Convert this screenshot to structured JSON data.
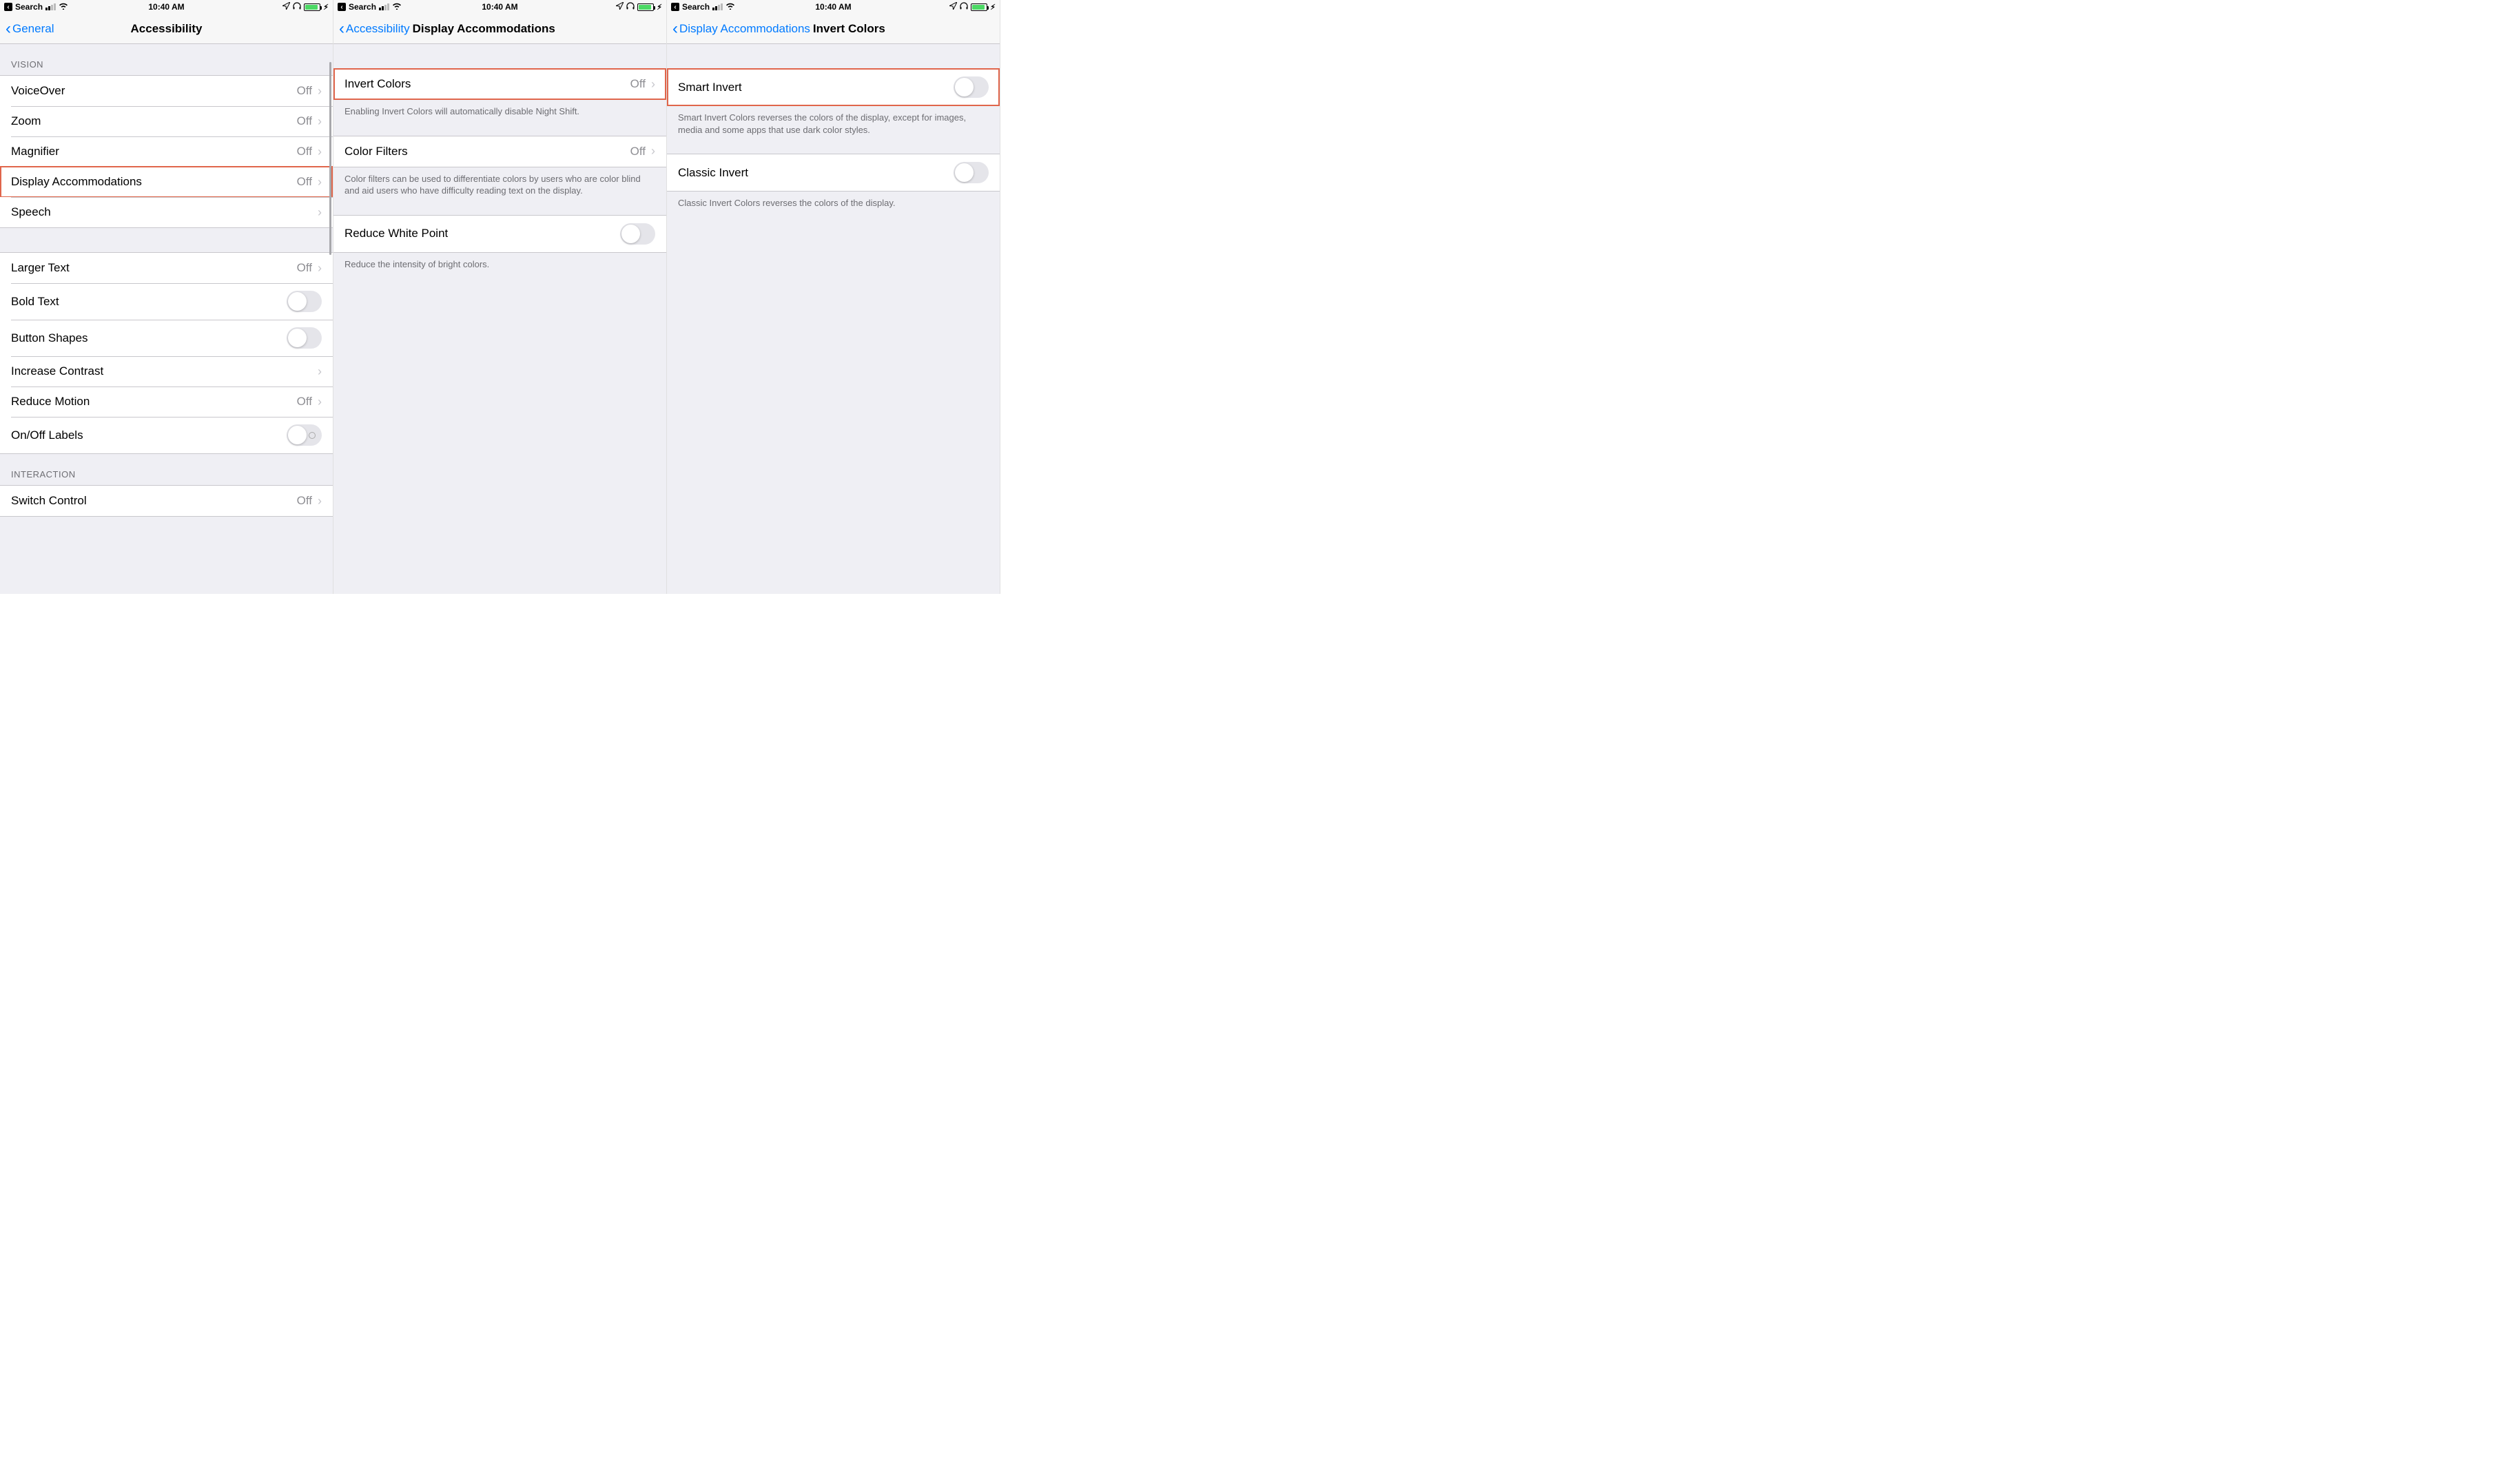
{
  "status": {
    "back_app": "Search",
    "time": "10:40 AM"
  },
  "screens": [
    {
      "back_label": "General",
      "title": "Accessibility",
      "sections": [
        {
          "header": "VISION",
          "rows": [
            {
              "label": "VoiceOver",
              "value": "Off",
              "kind": "disclosure"
            },
            {
              "label": "Zoom",
              "value": "Off",
              "kind": "disclosure"
            },
            {
              "label": "Magnifier",
              "value": "Off",
              "kind": "disclosure"
            },
            {
              "label": "Display Accommodations",
              "value": "Off",
              "kind": "disclosure",
              "highlight": true
            },
            {
              "label": "Speech",
              "value": "",
              "kind": "disclosure"
            }
          ]
        },
        {
          "rows": [
            {
              "label": "Larger Text",
              "value": "Off",
              "kind": "disclosure"
            },
            {
              "label": "Bold Text",
              "kind": "toggle",
              "on": false
            },
            {
              "label": "Button Shapes",
              "kind": "toggle",
              "on": false
            },
            {
              "label": "Increase Contrast",
              "value": "",
              "kind": "disclosure"
            },
            {
              "label": "Reduce Motion",
              "value": "Off",
              "kind": "disclosure"
            },
            {
              "label": "On/Off Labels",
              "kind": "toggle",
              "on": false,
              "labeled": true
            }
          ]
        },
        {
          "header": "INTERACTION",
          "rows": [
            {
              "label": "Switch Control",
              "value": "Off",
              "kind": "disclosure"
            }
          ]
        }
      ]
    },
    {
      "back_label": "Accessibility",
      "title": "Display Accommodations",
      "sections": [
        {
          "rows": [
            {
              "label": "Invert Colors",
              "value": "Off",
              "kind": "disclosure",
              "highlight": true
            }
          ],
          "footer": "Enabling Invert Colors will automatically disable Night Shift."
        },
        {
          "rows": [
            {
              "label": "Color Filters",
              "value": "Off",
              "kind": "disclosure"
            }
          ],
          "footer": "Color filters can be used to differentiate colors by users who are color blind and aid users who have difficulty reading text on the display."
        },
        {
          "rows": [
            {
              "label": "Reduce White Point",
              "kind": "toggle",
              "on": false
            }
          ],
          "footer": "Reduce the intensity of bright colors."
        }
      ]
    },
    {
      "back_label": "Display Accommodations",
      "title": "Invert Colors",
      "sections": [
        {
          "rows": [
            {
              "label": "Smart Invert",
              "kind": "toggle",
              "on": false,
              "highlight": true
            }
          ],
          "footer": "Smart Invert Colors reverses the colors of the display, except for images, media and some apps that use dark color styles."
        },
        {
          "rows": [
            {
              "label": "Classic Invert",
              "kind": "toggle",
              "on": false
            }
          ],
          "footer": "Classic Invert Colors reverses the colors of the display."
        }
      ]
    }
  ]
}
